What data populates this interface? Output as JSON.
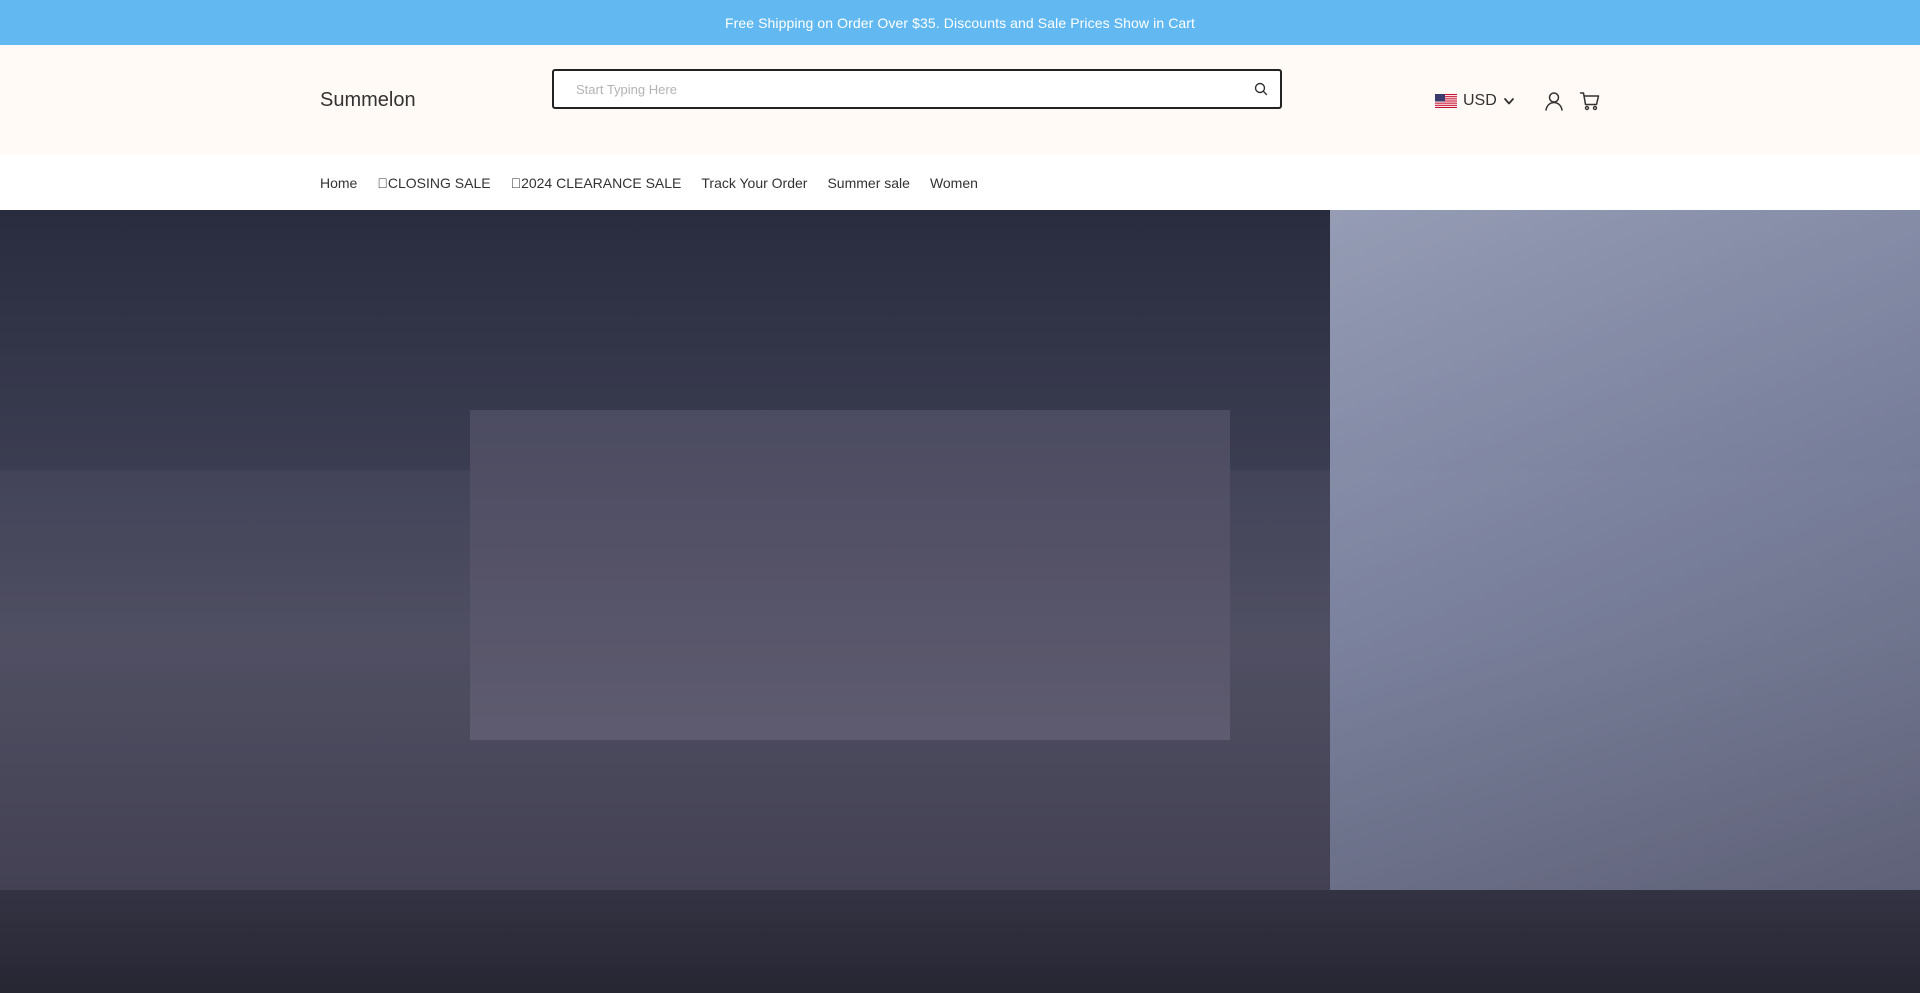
{
  "announcement": {
    "text": "Free Shipping on Order Over $35. Discounts and Sale Prices Show in Cart"
  },
  "header": {
    "logo": "Summelon",
    "search": {
      "placeholder": "Start Typing Here",
      "value": "",
      "icon": "search-icon"
    },
    "currency": {
      "flag": "us-flag-icon",
      "code": "USD",
      "icon": "chevron-down-icon"
    },
    "account_icon": "user-icon",
    "cart_icon": "cart-icon"
  },
  "nav": {
    "items": [
      {
        "label": "Home"
      },
      {
        "label": "􀀀CLOSING SALE"
      },
      {
        "label": "􀀀2024 CLEARANCE SALE"
      },
      {
        "label": "Track Your Order"
      },
      {
        "label": "Summer sale"
      },
      {
        "label": "Women"
      }
    ]
  },
  "hero": {
    "image": "store-interior-photo"
  },
  "colors": {
    "announcement_bg": "#62b9f2",
    "header_bg": "#fffaf5"
  }
}
